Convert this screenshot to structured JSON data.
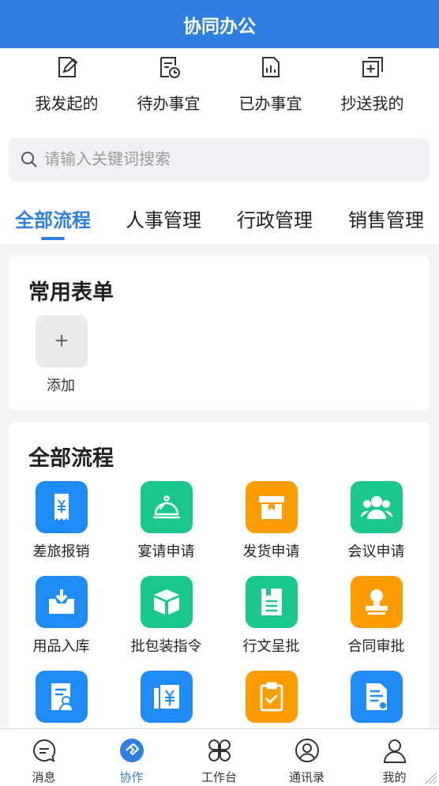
{
  "header": {
    "title": "协同办公"
  },
  "quick_actions": [
    {
      "label": "我发起的",
      "icon": "edit-doc-icon"
    },
    {
      "label": "待办事宜",
      "icon": "pending-clock-icon"
    },
    {
      "label": "已办事宜",
      "icon": "done-report-icon"
    },
    {
      "label": "抄送我的",
      "icon": "copy-add-icon"
    }
  ],
  "search": {
    "placeholder": "请输入关键词搜索"
  },
  "tabs": [
    {
      "label": "全部流程",
      "active": true
    },
    {
      "label": "人事管理",
      "active": false
    },
    {
      "label": "行政管理",
      "active": false
    },
    {
      "label": "销售管理",
      "active": false
    }
  ],
  "common_forms": {
    "title": "常用表单",
    "add_label": "添加",
    "add_symbol": "+"
  },
  "all_processes": {
    "title": "全部流程",
    "items": [
      {
        "label": "差旅报销",
        "icon": "receipt-yen-icon",
        "color": "#1f8bf5"
      },
      {
        "label": "宴请申请",
        "icon": "dining-cloche-icon",
        "color": "#19c88a"
      },
      {
        "label": "发货申请",
        "icon": "package-box-icon",
        "color": "#ff9c00"
      },
      {
        "label": "会议申请",
        "icon": "people-group-icon",
        "color": "#19c88a"
      },
      {
        "label": "用品入库",
        "icon": "inbox-download-icon",
        "color": "#1f8bf5"
      },
      {
        "label": "批包装指令",
        "icon": "open-box-icon",
        "color": "#19c88a"
      },
      {
        "label": "行文呈批",
        "icon": "document-lines-icon",
        "color": "#19c88a"
      },
      {
        "label": "合同审批",
        "icon": "stamp-seal-icon",
        "color": "#ff9c00"
      },
      {
        "label": "",
        "icon": "user-document-icon",
        "color": "#1f8bf5"
      },
      {
        "label": "",
        "icon": "yen-invoice-icon",
        "color": "#1f8bf5"
      },
      {
        "label": "",
        "icon": "clipboard-check-icon",
        "color": "#ff9c00"
      },
      {
        "label": "",
        "icon": "document-pen-icon",
        "color": "#1f8bf5"
      }
    ]
  },
  "tabbar": [
    {
      "label": "消息",
      "icon": "message-icon",
      "active": false
    },
    {
      "label": "协作",
      "icon": "handshake-icon",
      "active": true
    },
    {
      "label": "工作台",
      "icon": "workbench-icon",
      "active": false
    },
    {
      "label": "通讯录",
      "icon": "contacts-icon",
      "active": false
    },
    {
      "label": "我的",
      "icon": "profile-icon",
      "active": false
    }
  ],
  "colors": {
    "primary": "#2f7fe2",
    "blue": "#1f8bf5",
    "green": "#19c88a",
    "orange": "#ff9c00"
  }
}
